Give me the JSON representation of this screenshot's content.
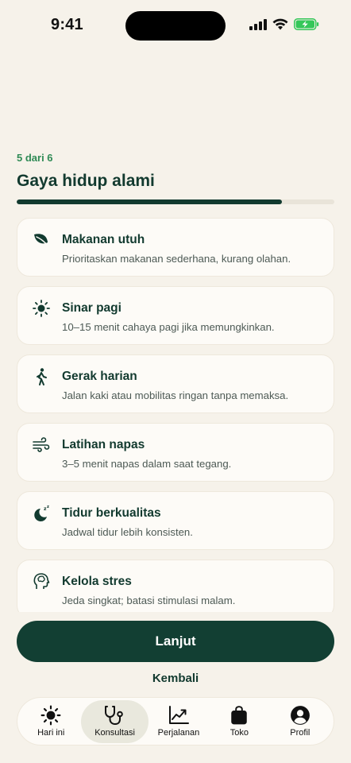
{
  "status": {
    "time": "9:41"
  },
  "header": {
    "step": "5 dari 6",
    "title": "Gaya hidup alami",
    "progress": 0.835
  },
  "items": [
    {
      "icon": "leaf-icon",
      "title": "Makanan utuh",
      "desc": "Prioritaskan makanan sederhana, kurang olahan."
    },
    {
      "icon": "sun-icon",
      "title": "Sinar pagi",
      "desc": "10–15 menit cahaya pagi jika memungkinkan."
    },
    {
      "icon": "walking-icon",
      "title": "Gerak harian",
      "desc": "Jalan kaki atau mobilitas ringan tanpa memaksa."
    },
    {
      "icon": "wind-icon",
      "title": "Latihan napas",
      "desc": "3–5 menit napas dalam saat tegang."
    },
    {
      "icon": "moon-sleep-icon",
      "title": "Tidur berkualitas",
      "desc": "Jadwal tidur lebih konsisten."
    },
    {
      "icon": "head-brain-icon",
      "title": "Kelola stres",
      "desc": "Jeda singkat; batasi stimulasi malam."
    }
  ],
  "actions": {
    "continue_label": "Lanjut",
    "back_label": "Kembali"
  },
  "nav": [
    {
      "icon": "sun-icon",
      "label": "Hari ini",
      "active": false
    },
    {
      "icon": "stethoscope-icon",
      "label": "Konsultasi",
      "active": true
    },
    {
      "icon": "chart-trend-icon",
      "label": "Perjalanan",
      "active": false
    },
    {
      "icon": "shopping-bag-icon",
      "label": "Toko",
      "active": false
    },
    {
      "icon": "profile-icon",
      "label": "Profil",
      "active": false
    }
  ],
  "colors": {
    "accent": "#123f33",
    "step": "#2e8a55",
    "background": "#f6f2ea",
    "battery": "#34c759"
  }
}
